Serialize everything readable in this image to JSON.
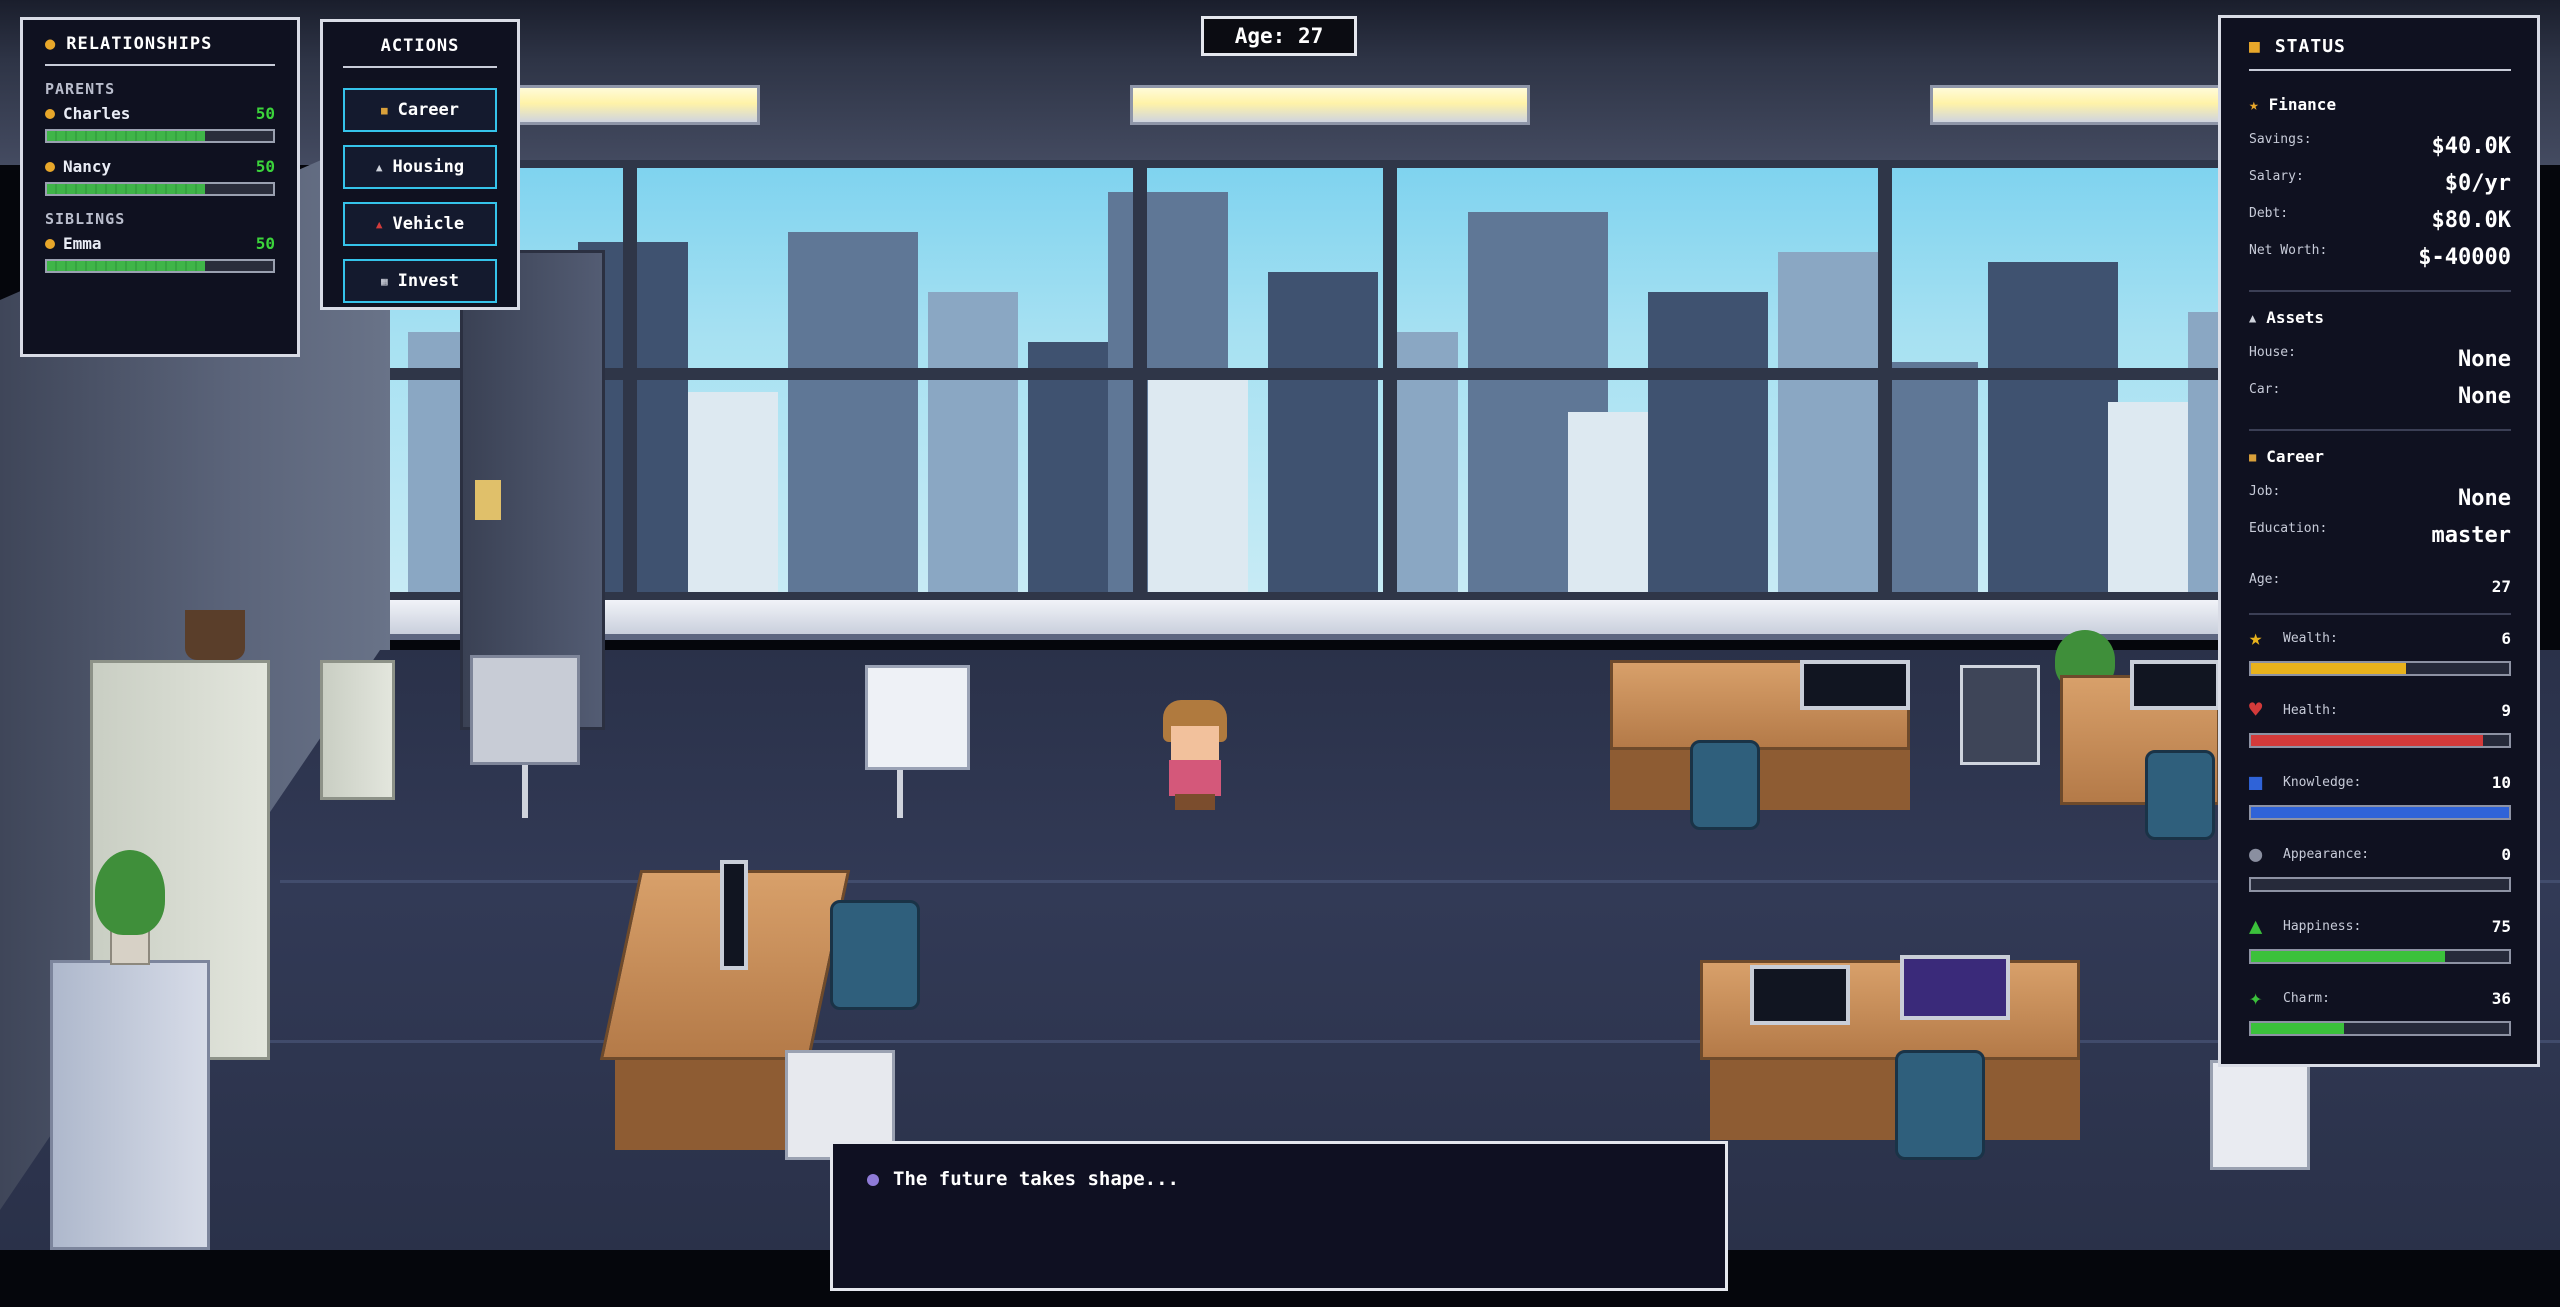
{
  "relationships": {
    "title": "RELATIONSHIPS",
    "groups": [
      {
        "label": "PARENTS",
        "people": [
          {
            "name": "Charles",
            "value": "50",
            "level": 0.7
          },
          {
            "name": "Nancy",
            "value": "50",
            "level": 0.7
          }
        ]
      },
      {
        "label": "SIBLINGS",
        "people": [
          {
            "name": "Emma",
            "value": "50",
            "level": 0.7
          }
        ]
      }
    ]
  },
  "actions": {
    "title": "ACTIONS",
    "buttons": [
      {
        "label": "Career",
        "icon": "briefcase-icon"
      },
      {
        "label": "Housing",
        "icon": "house-icon"
      },
      {
        "label": "Vehicle",
        "icon": "car-icon"
      },
      {
        "label": "Invest",
        "icon": "chart-icon"
      }
    ]
  },
  "age_display": "Age: 27",
  "status": {
    "title": "STATUS",
    "finance": {
      "title": "Finance",
      "items": [
        {
          "label": "Savings:",
          "value": "$40.0K"
        },
        {
          "label": "Salary:",
          "value": "$0/yr"
        },
        {
          "label": "Debt:",
          "value": "$80.0K"
        },
        {
          "label": "Net Worth:",
          "value": "$-40000"
        }
      ]
    },
    "assets": {
      "title": "Assets",
      "items": [
        {
          "label": "House:",
          "value": "None"
        },
        {
          "label": "Car:",
          "value": "None"
        }
      ]
    },
    "career": {
      "title": "Career",
      "items": [
        {
          "label": "Job:",
          "value": "None"
        },
        {
          "label": "Education:",
          "value": "master"
        }
      ],
      "age_label": "Age:",
      "age_value": "27"
    },
    "stats": [
      {
        "label": "Wealth:",
        "value": "6",
        "fraction": 0.6,
        "color": "#e8b21c",
        "icon": "trophy-icon"
      },
      {
        "label": "Health:",
        "value": "9",
        "fraction": 0.9,
        "color": "#d33a3a",
        "icon": "heart-icon"
      },
      {
        "label": "Knowledge:",
        "value": "10",
        "fraction": 1.0,
        "color": "#2f63d8",
        "icon": "book-icon"
      },
      {
        "label": "Appearance:",
        "value": "0",
        "fraction": 0.0,
        "color": "#8a8fa0",
        "icon": "mirror-icon"
      },
      {
        "label": "Happiness:",
        "value": "75",
        "fraction": 0.75,
        "color": "#3bc13b",
        "icon": "muscle-icon"
      },
      {
        "label": "Charm:",
        "value": "36",
        "fraction": 0.36,
        "color": "#3bc13b",
        "icon": "sparkle-icon"
      }
    ]
  },
  "dialog": {
    "text": "The future takes shape..."
  }
}
